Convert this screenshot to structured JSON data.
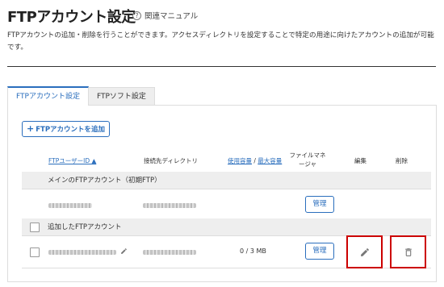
{
  "header": {
    "title": "FTPアカウント設定",
    "manual_icon": "help-circle-icon",
    "manual_label": "関連マニュアル",
    "description": "FTPアカウントの追加・削除を行うことができます。アクセスディレクトリを設定することで特定の用途に向けたアカウントの追加が可能です。"
  },
  "tabs": [
    {
      "label": "FTPアカウント設定",
      "active": true
    },
    {
      "label": "FTPソフト設定",
      "active": false
    }
  ],
  "toolbar": {
    "add_label": "FTPアカウントを追加"
  },
  "table": {
    "columns": {
      "ftp_user_id": "FTPユーザーID ▲",
      "directory": "接続先ディレクトリ",
      "usage_label": "使用容量",
      "usage_separator": " / ",
      "max_label": "最大容量",
      "file_manager": "ファイルマネージャ",
      "edit": "編集",
      "delete": "削除"
    },
    "sections": [
      {
        "label": "メインのFTPアカウント（初期FTP）",
        "rows": [
          {
            "manage_label": "管理"
          }
        ]
      },
      {
        "label": "追加したFTPアカウント",
        "rows": [
          {
            "usage": "0 / 3 MB",
            "manage_label": "管理",
            "edit_icon": "pencil-icon",
            "delete_icon": "trash-icon"
          }
        ]
      }
    ]
  },
  "colors": {
    "accent": "#2a6ebd",
    "highlight": "#cc0000"
  }
}
